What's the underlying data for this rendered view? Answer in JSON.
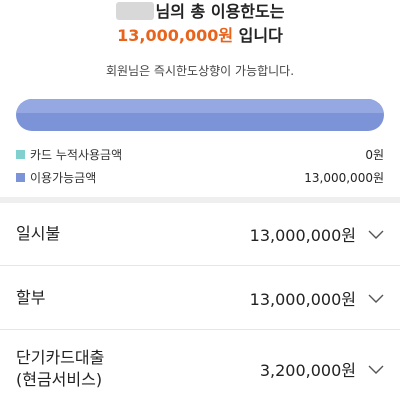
{
  "header": {
    "title_suffix": "님의 총 이용한도는",
    "total_amount": "13,000,000원",
    "title_tail": " 입니다",
    "subtitle": "회원님은 즉시한도상향이 가능합니다."
  },
  "usage": {
    "used_fraction": 0,
    "colors": {
      "used": "#7fd0cf",
      "available": "#7c93d8",
      "accent": "#e8641c"
    }
  },
  "legend": [
    {
      "label": "카드 누적사용금액",
      "value": "0원"
    },
    {
      "label": "이용가능금액",
      "value": "13,000,000원"
    }
  ],
  "limits": [
    {
      "label": "일시불",
      "amount": "13,000,000원",
      "icon": "chevron-down-icon"
    },
    {
      "label": "할부",
      "amount": "13,000,000원",
      "icon": "chevron-down-icon"
    },
    {
      "label_line1": "단기카드대출",
      "label_line2": "(현금서비스)",
      "amount": "3,200,000원",
      "icon": "chevron-down-icon"
    }
  ]
}
